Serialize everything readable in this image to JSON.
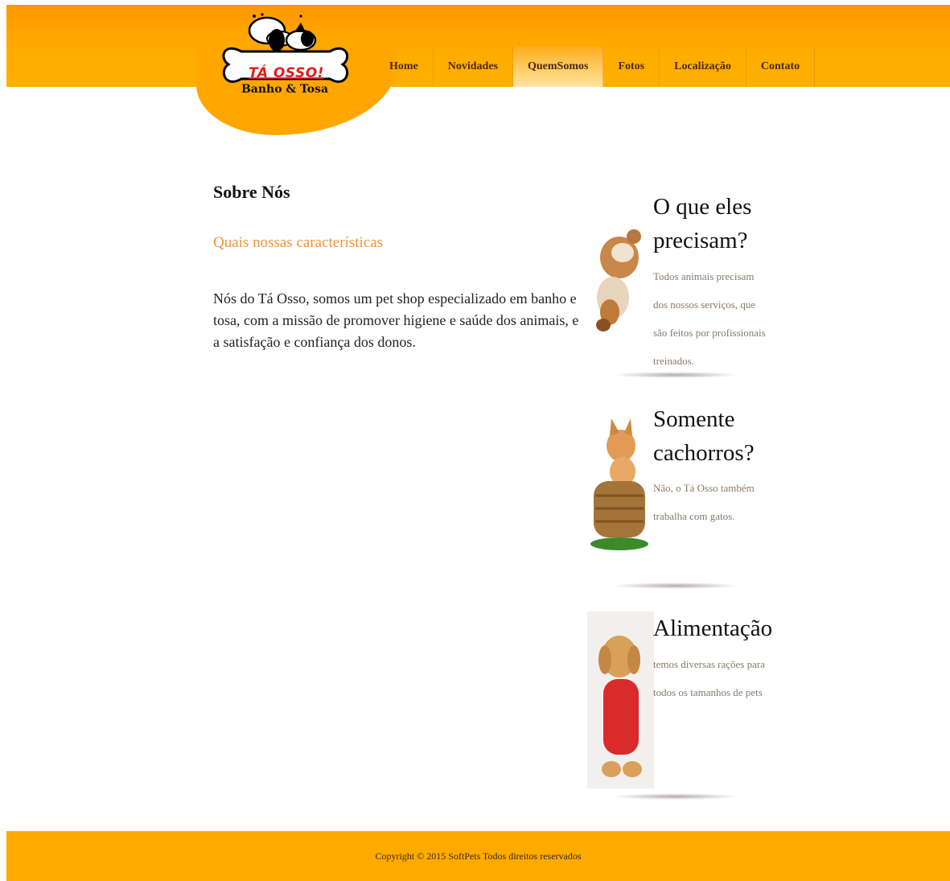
{
  "brand": {
    "logo_title": "TÁ OSSO!",
    "logo_subtitle": "Banho & Tosa"
  },
  "nav": {
    "items": [
      {
        "label": "Home"
      },
      {
        "label": "Novidades"
      },
      {
        "label": "QuemSomos"
      },
      {
        "label": "Fotos"
      },
      {
        "label": "Localização"
      },
      {
        "label": "Contato"
      }
    ],
    "active": "QuemSomos"
  },
  "main": {
    "title": "Sobre Nós",
    "subtitle": "Quais nossas características",
    "body": "Nós do Tá Osso, somos um pet shop especializado em banho e tosa, com a missão de promover higiene e saúde dos animais, e a satisfação e confiança dos donos."
  },
  "sidebar": {
    "cards": [
      {
        "title": "O que eles precisam?",
        "text": "Todos animais precisam dos nossos serviços, que são feitos por profissionais treinados.",
        "image_icon": "puppy-and-kitten-icon"
      },
      {
        "title": "Somente cachorros?",
        "text": "Não, o Tá Osso também trabalha com gatos.",
        "image_icon": "kitten-in-basket-icon"
      },
      {
        "title": "Alimentação",
        "text": "temos diversas rações para todos os tamanhos de pets",
        "image_icon": "dog-in-red-hoodie-icon"
      }
    ]
  },
  "footer": {
    "copyright": "Copyright © 2015 SoftPets Todos direitos reservados"
  },
  "colors": {
    "header_orange": "#ffa600",
    "footer_orange": "#ffaa00",
    "subtitle_orange": "#f2923a",
    "logo_red": "#e41b1b"
  }
}
